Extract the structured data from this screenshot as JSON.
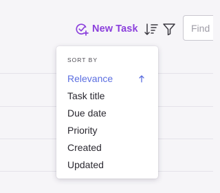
{
  "toolbar": {
    "new_task_label": "New Task",
    "new_task_icon": "circle-check-plus-icon",
    "sort_icon": "sort-descending-icon",
    "filter_icon": "filter-funnel-icon",
    "search_placeholder": "Find",
    "accent_color": "#8b3fdc"
  },
  "sort_menu": {
    "heading": "SORT BY",
    "active_color": "#5b6ee0",
    "selected_direction_icon": "arrow-up-icon",
    "items": [
      {
        "label": "Relevance",
        "selected": true
      },
      {
        "label": "Task title"
      },
      {
        "label": "Due date"
      },
      {
        "label": "Priority"
      },
      {
        "label": "Created"
      },
      {
        "label": "Updated"
      }
    ]
  }
}
